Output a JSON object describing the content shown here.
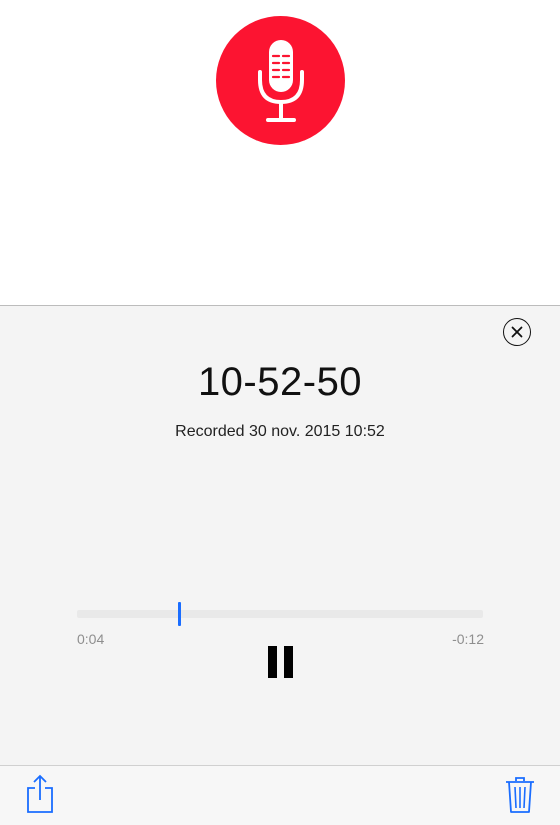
{
  "recorder": {
    "record_icon": "microphone-icon",
    "accent_color": "#fc1431"
  },
  "player": {
    "title": "10-52-50",
    "recorded_label": "Recorded 30 nov. 2015 10:52",
    "elapsed": "0:04",
    "remaining": "-0:12",
    "progress": 0.25,
    "accent_color": "#1a6dff",
    "state": "playing"
  },
  "toolbar": {
    "share_icon": "share-icon",
    "trash_icon": "trash-icon",
    "tint_color": "#1a6dff"
  }
}
